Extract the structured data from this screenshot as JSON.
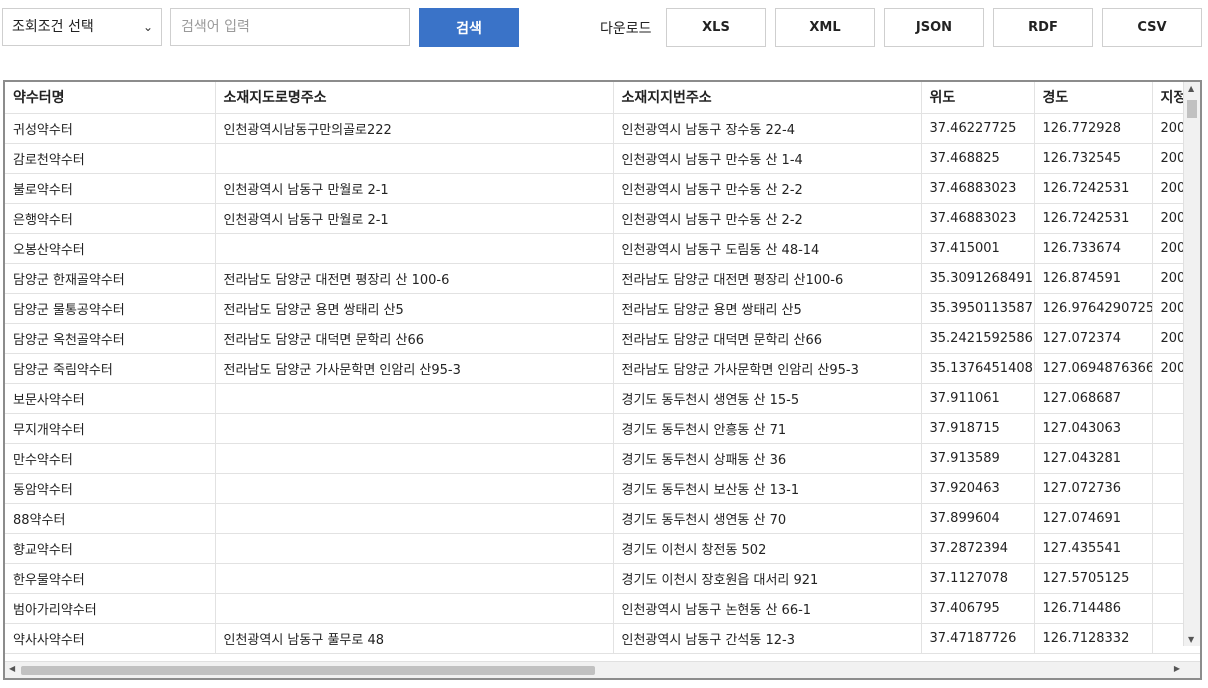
{
  "toolbar": {
    "select_value": "조회조건 선택",
    "search_placeholder": "검색어 입력",
    "search_label": "검색",
    "download_label": "다운로드",
    "download_buttons": [
      "XLS",
      "XML",
      "JSON",
      "RDF",
      "CSV"
    ]
  },
  "table": {
    "columns": [
      "약수터명",
      "소재지도로명주소",
      "소재지지번주소",
      "위도",
      "경도",
      "지정"
    ],
    "rows": [
      [
        "귀성약수터",
        "인천광역시남동구만의골로222",
        "인천광역시 남동구 장수동 22-4",
        "37.46227725",
        "126.772928",
        "200"
      ],
      [
        "감로천약수터",
        "",
        "인천광역시 남동구 만수동 산 1-4",
        "37.468825",
        "126.732545",
        "200"
      ],
      [
        "불로약수터",
        "인천광역시 남동구 만월로 2-1",
        "인천광역시 남동구 만수동 산 2-2",
        "37.46883023",
        "126.7242531",
        "200"
      ],
      [
        "은행약수터",
        "인천광역시 남동구 만월로 2-1",
        "인천광역시 남동구 만수동 산 2-2",
        "37.46883023",
        "126.7242531",
        "200"
      ],
      [
        "오봉산약수터",
        "",
        "인천광역시 남동구 도림동 산 48-14",
        "37.415001",
        "126.733674",
        "200"
      ],
      [
        "담양군 한재골약수터",
        "전라남도 담양군 대전면 평장리 산 100-6",
        "전라남도 담양군 대전면 평장리 산100-6",
        "35.3091268491",
        "126.874591",
        "200"
      ],
      [
        "담양군 물통공약수터",
        "전라남도 담양군 용면 쌍태리 산5",
        "전라남도 담양군 용면 쌍태리 산5",
        "35.3950113587",
        "126.9764290725",
        "200"
      ],
      [
        "담양군 옥천골약수터",
        "전라남도 담양군 대덕면 문학리 산66",
        "전라남도 담양군 대덕면 문학리 산66",
        "35.2421592586",
        "127.072374",
        "200"
      ],
      [
        "담양군 죽림약수터",
        "전라남도 담양군 가사문학면 인암리 산95-3",
        "전라남도 담양군 가사문학면 인암리 산95-3",
        "35.1376451408",
        "127.0694876366",
        "200"
      ],
      [
        "보문사약수터",
        "",
        "경기도 동두천시 생연동 산 15-5",
        "37.911061",
        "127.068687",
        ""
      ],
      [
        "무지개약수터",
        "",
        "경기도 동두천시 안흥동 산 71",
        "37.918715",
        "127.043063",
        ""
      ],
      [
        "만수약수터",
        "",
        "경기도 동두천시 상패동 산 36",
        "37.913589",
        "127.043281",
        ""
      ],
      [
        "동암약수터",
        "",
        "경기도 동두천시 보산동 산 13-1",
        "37.920463",
        "127.072736",
        ""
      ],
      [
        "88약수터",
        "",
        "경기도 동두천시 생연동 산 70",
        "37.899604",
        "127.074691",
        ""
      ],
      [
        "향교약수터",
        "",
        "경기도 이천시 창전동 502",
        "37.2872394",
        "127.435541",
        ""
      ],
      [
        "한우물약수터",
        "",
        "경기도 이천시 장호원읍 대서리 921",
        "37.1127078",
        "127.5705125",
        ""
      ],
      [
        "범아가리약수터",
        "",
        "인천광역시 남동구 논현동 산 66-1",
        "37.406795",
        "126.714486",
        ""
      ],
      [
        "약사사약수터",
        "인천광역시 남동구 풀무로 48",
        "인천광역시 남동구 간석동 12-3",
        "37.47187726",
        "126.7128332",
        ""
      ]
    ]
  }
}
